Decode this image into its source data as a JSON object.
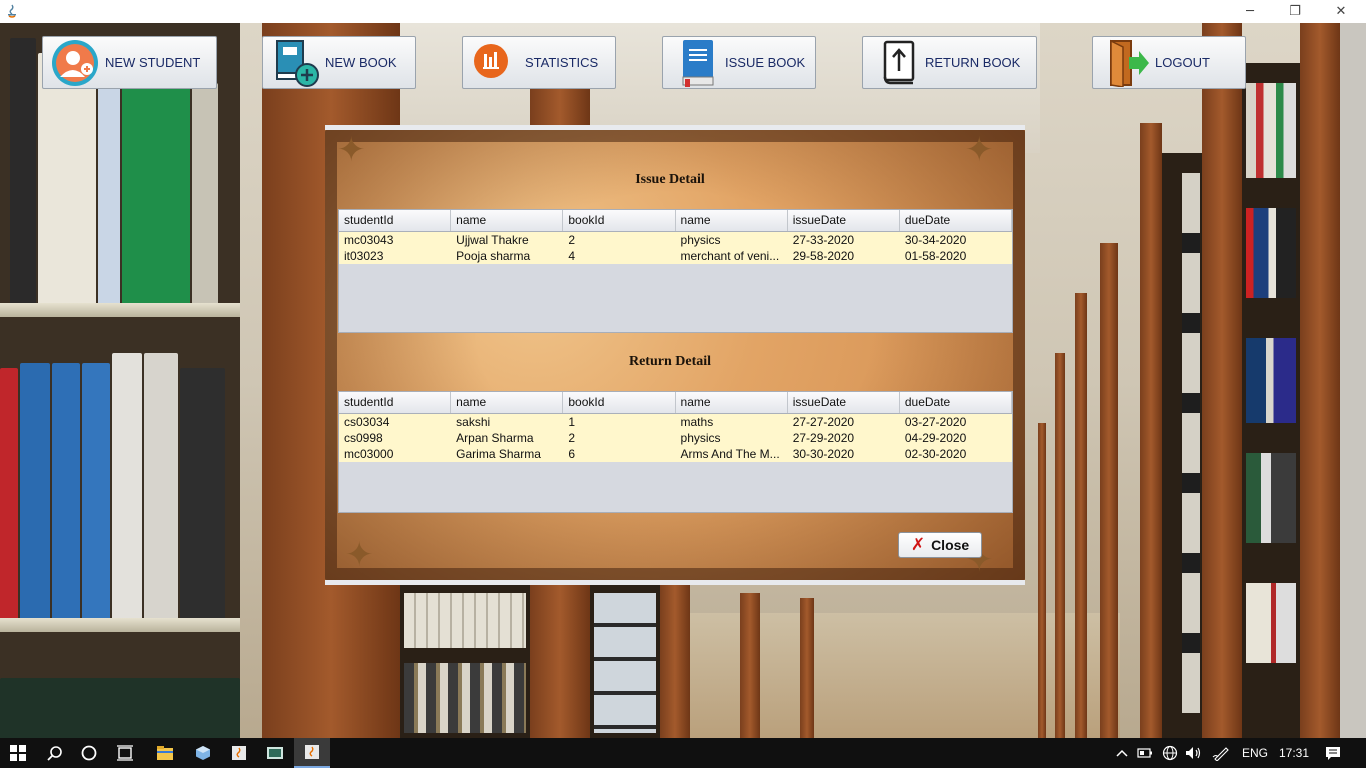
{
  "window": {
    "app_icon": "java-icon",
    "controls": {
      "minimize": "─",
      "maximize": "❐",
      "close": "✕"
    }
  },
  "toolbar": [
    {
      "label": "NEW STUDENT",
      "icon": "student-avatar-icon"
    },
    {
      "label": "NEW BOOK",
      "icon": "add-book-icon"
    },
    {
      "label": "STATISTICS",
      "icon": "statistics-icon"
    },
    {
      "label": "ISSUE BOOK",
      "icon": "book-icon"
    },
    {
      "label": "RETURN BOOK",
      "icon": "return-book-icon"
    },
    {
      "label": "LOGOUT",
      "icon": "logout-door-icon"
    }
  ],
  "dialog": {
    "issue": {
      "title": "Issue Detail",
      "columns": [
        "studentId",
        "name",
        "bookId",
        "name",
        "issueDate",
        "dueDate"
      ],
      "rows": [
        [
          "mc03043",
          "Ujjwal Thakre",
          "2",
          "physics",
          "27-33-2020",
          "30-34-2020"
        ],
        [
          "it03023",
          "Pooja sharma",
          "4",
          "merchant of veni...",
          "29-58-2020",
          "01-58-2020"
        ]
      ]
    },
    "return": {
      "title": "Return Detail",
      "columns": [
        "studentId",
        "name",
        "bookId",
        "name",
        "issueDate",
        "dueDate"
      ],
      "rows": [
        [
          "cs03034",
          "sakshi",
          "1",
          "maths",
          "27-27-2020",
          "03-27-2020"
        ],
        [
          "cs0998",
          "Arpan Sharma",
          "2",
          "physics",
          "27-29-2020",
          "04-29-2020"
        ],
        [
          "mc03000",
          "Garima Sharma",
          "6",
          "Arms And The M...",
          "30-30-2020",
          "02-30-2020"
        ]
      ]
    },
    "close_label": "Close",
    "close_icon": "red-x-icon"
  },
  "taskbar": {
    "language": "ENG",
    "time": "17:31",
    "icons": [
      "windows-start-icon",
      "search-icon",
      "cortana-icon",
      "task-view-icon",
      "file-explorer-icon",
      "virtualbox-icon",
      "java-app-icon",
      "terminal-icon",
      "java-app-active-icon"
    ],
    "tray_icons": [
      "chevron-up-icon",
      "battery-icon",
      "network-globe-icon",
      "volume-icon",
      "pen-icon",
      "notifications-icon"
    ]
  }
}
